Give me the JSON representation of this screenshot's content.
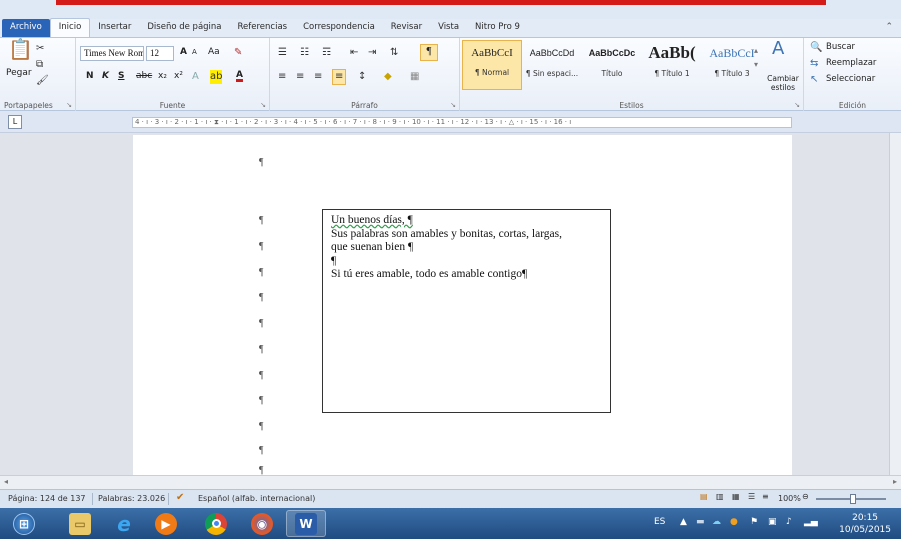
{
  "tabs": [
    "Archivo",
    "Inicio",
    "Insertar",
    "Diseño de página",
    "Referencias",
    "Correspondencia",
    "Revisar",
    "Vista",
    "Nitro Pro 9"
  ],
  "active_tab": "Inicio",
  "ribbon": {
    "clipboard": {
      "label": "Portapapeles",
      "paste": "Pegar"
    },
    "font": {
      "label": "Fuente",
      "name": "Times New Rom",
      "size": "12",
      "bold": "N",
      "italic": "K",
      "underline": "S",
      "strike": "abc",
      "subscript": "x₂",
      "superscript": "x²",
      "grow": "A",
      "shrink": "A",
      "case": "Aa",
      "font_color": "A"
    },
    "paragraph": {
      "label": "Párrafo",
      "show_marks": "¶"
    },
    "styles": {
      "label": "Estilos",
      "items": [
        {
          "sample": "AaBbCcI",
          "name": "¶ Normal"
        },
        {
          "sample": "AaBbCcDd",
          "name": "¶ Sin espaci..."
        },
        {
          "sample": "AaBbCcDc",
          "name": "Título"
        },
        {
          "sample": "AaBb(",
          "name": "¶ Título 1"
        },
        {
          "sample": "AaBbCcI",
          "name": "¶ Título 3"
        }
      ],
      "change": "Cambiar estilos"
    },
    "editing": {
      "label": "Edición",
      "find": "Buscar",
      "replace": "Reemplazar",
      "select": "Seleccionar"
    }
  },
  "ruler_text": "4 · ı · 3 · ı · 2 · ı · 1 · ı · ⧗ · ı · 1 · ı · 2 · ı · 3 · ı · 4 · ı · 5 · ı · 6 · ı · 7 · ı · 8 · ı · 9 · ı · 10 · ı · 11 · ı · 12 · ı · 13 · ı · △ · ı · 15 · ı · 16 · ı",
  "document": {
    "textbox_lines": [
      "Un buenos días, ¶",
      "Sus palabras son amables y bonitas, cortas, largas,",
      "que suenan bien ¶",
      "¶",
      "Si  tú eres amable, todo es amable contigo¶"
    ],
    "para_mark": "¶"
  },
  "status": {
    "page": "Página: 124 de 137",
    "words": "Palabras: 23.026",
    "language": "Español (alfab. internacional)",
    "zoom": "100%"
  },
  "taskbar": {
    "apps": [
      "start",
      "explorer",
      "internet-explorer",
      "media-player",
      "chrome",
      "firefox",
      "word"
    ],
    "lang": "ES",
    "time": "20:15",
    "date": "10/05/2015"
  }
}
